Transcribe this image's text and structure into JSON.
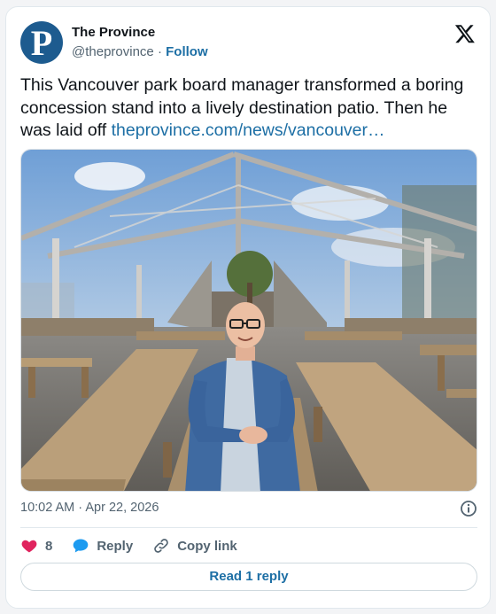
{
  "account": {
    "name": "The Province",
    "handle": "@theprovince",
    "separator": "·",
    "follow_label": "Follow",
    "avatar_letter": "P",
    "avatar_color": "#1d5b8f"
  },
  "tweet": {
    "text": "This Vancouver park board manager transformed a boring concession stand into a lively destination patio. Then he was laid off ",
    "link": "theprovince.com/news/vancouver…",
    "time": "10:02 AM",
    "date_separator": "·",
    "date": "Apr 22, 2026"
  },
  "actions": {
    "like_count": "8",
    "reply_label": "Reply",
    "copy_link_label": "Copy link",
    "read_replies_label": "Read 1 reply"
  },
  "icons": [
    "x-logo-icon",
    "info-icon",
    "heart-icon",
    "reply-bubble-icon",
    "link-icon"
  ],
  "colors": {
    "accent": "#1d6fa5",
    "like": "#e0245e",
    "reply": "#1d9bf0"
  }
}
